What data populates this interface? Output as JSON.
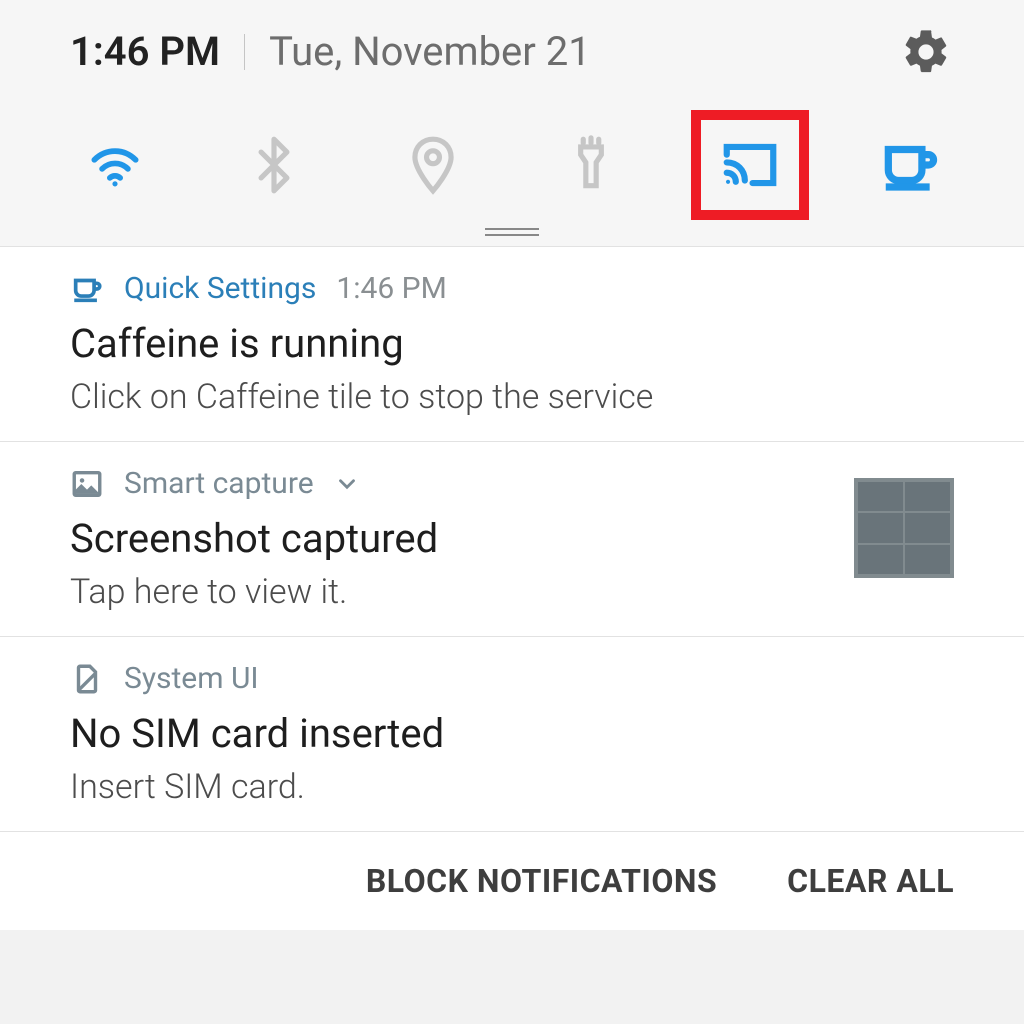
{
  "status": {
    "time": "1:46 PM",
    "date": "Tue, November 21"
  },
  "tiles": {
    "wifi": "wifi-icon",
    "bluetooth": "bluetooth-icon",
    "location": "location-icon",
    "flashlight": "flashlight-icon",
    "cast": "cast-icon",
    "caffeine": "coffee-icon"
  },
  "notifications": [
    {
      "app": "Quick Settings",
      "time": "1:46 PM",
      "title": "Caffeine is running",
      "body": "Click on Caffeine tile to stop the service",
      "icon": "coffee-icon",
      "expandable": false,
      "thumb": false
    },
    {
      "app": "Smart capture",
      "time": "",
      "title": "Screenshot captured",
      "body": "Tap here to view it.",
      "icon": "image-icon",
      "expandable": true,
      "thumb": true
    },
    {
      "app": "System UI",
      "time": "",
      "title": "No SIM card inserted",
      "body": "Insert SIM card.",
      "icon": "sim-icon",
      "expandable": false,
      "thumb": false
    }
  ],
  "footer": {
    "block": "Block Notifications",
    "clear": "Clear All"
  },
  "colors": {
    "active": "#2196e8",
    "inactive": "#c6c6c6",
    "highlight": "#ee1c25"
  }
}
